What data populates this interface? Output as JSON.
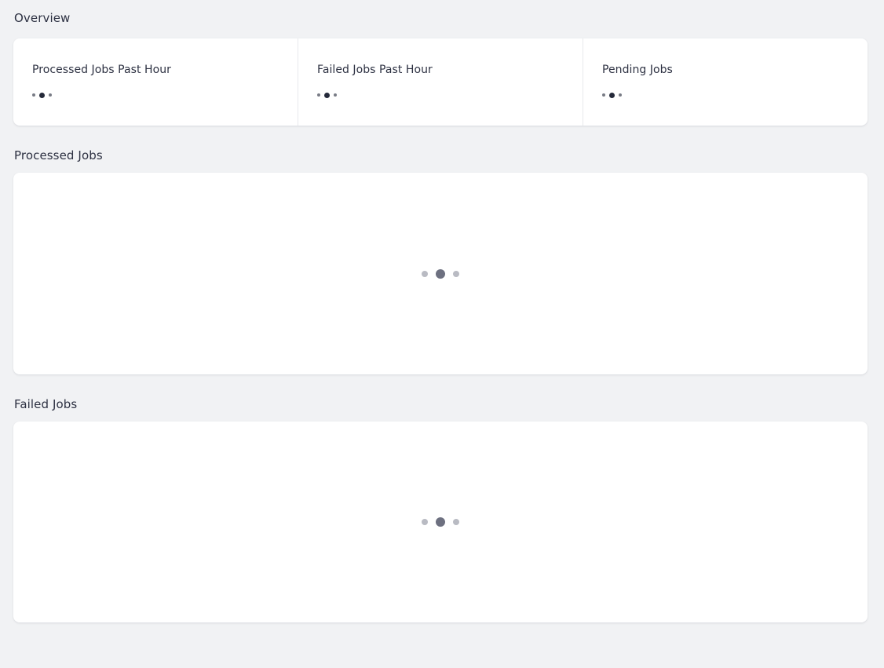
{
  "page": {
    "background_color": "#f1f2f4",
    "text_color": "#2d3142"
  },
  "overview": {
    "heading": "Overview",
    "stats": [
      {
        "title": "Processed Jobs Past Hour",
        "value": "",
        "state": "loading"
      },
      {
        "title": "Failed Jobs Past Hour",
        "value": "",
        "state": "loading"
      },
      {
        "title": "Pending Jobs",
        "value": "",
        "state": "loading"
      }
    ],
    "loader": {
      "icon": "loading-dots-icon",
      "dot_color": "#252a3a",
      "dot_count": 3
    }
  },
  "panels": [
    {
      "heading": "Processed Jobs",
      "state": "loading",
      "loader": {
        "icon": "loading-dots-icon",
        "dot_color_outer": "#b9bbc3",
        "dot_color_center": "#6d7080",
        "dot_count": 3
      }
    },
    {
      "heading": "Failed Jobs",
      "state": "loading",
      "loader": {
        "icon": "loading-dots-icon",
        "dot_color_outer": "#b9bbc3",
        "dot_color_center": "#6d7080",
        "dot_count": 3
      }
    }
  ]
}
